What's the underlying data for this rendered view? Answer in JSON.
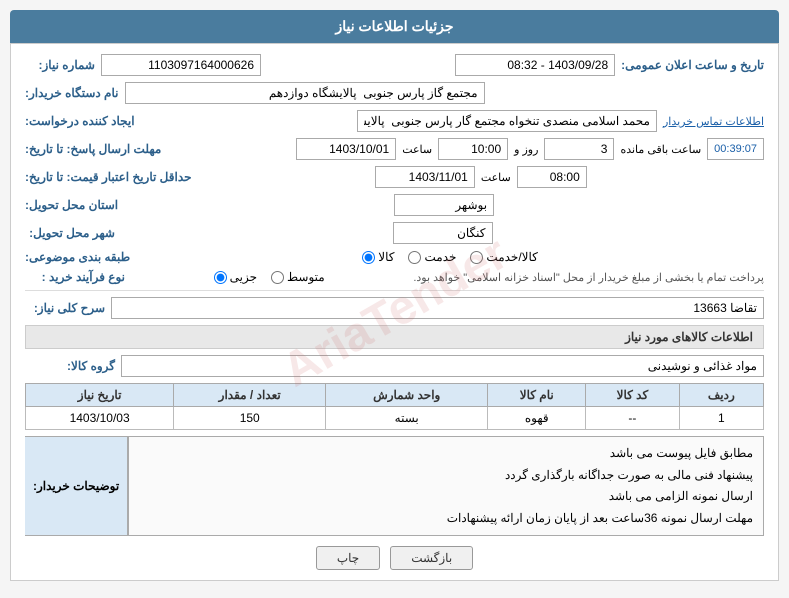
{
  "header": {
    "title": "جزئیات اطلاعات نیاز"
  },
  "fields": {
    "shomara_niaz_label": "شماره نیاز:",
    "shomara_niaz_value": "1103097164000626",
    "tarikh_label": "تاریخ و ساعت اعلان عمومی:",
    "tarikh_value": "1403/09/28 - 08:32",
    "nam_dastgah_label": "نام دستگاه خریدار:",
    "nam_dastgah_value": "مجتمع گاز پارس جنوبی  پالایشگاه دوازدهم",
    "ijad_konande_label": "ایجاد کننده درخواست:",
    "ijad_konande_value": "محمد اسلامی منصدی تنخواه مجتمع گار پارس جنوبی  پالایشگاه دوازدهم",
    "ettelaat_tamas_label": "اطلاعات تماس خریدار",
    "mohlat_ersal_label": "مهلت ارسال پاسخ: تا تاریخ:",
    "mohlat_ersal_date": "1403/10/01",
    "mohlat_ersal_saat": "10:00",
    "mohlat_ersal_saat_label": "ساعت",
    "rooz_label": "روز و",
    "rooz_value": "3",
    "baqi_saat_label": "ساعت باقی مانده",
    "baqi_value": "00:39:07",
    "hadaghal_label": "حداقل تاریخ اعتبار قیمت: تا تاریخ:",
    "hadaghal_date": "1403/11/01",
    "hadaghal_saat": "08:00",
    "hadaghal_saat_label": "ساعت",
    "ostan_label": "استان محل تحویل:",
    "ostan_value": "بوشهر",
    "shahr_label": "شهر محل تحویل:",
    "shahr_value": "کنگان",
    "tabagheh_label": "طبقه بندی موضوعی:",
    "tabagheh_kala": "کالا",
    "tabagheh_khadamat": "خدمت",
    "tabagheh_kala_khadamat": "کالا/خدمت",
    "noe_farayand_label": "نوع فرآیند خرید :",
    "noe_jozii": "جزیی",
    "noe_motavasset": "متوسط",
    "noe_description": "پرداخت تمام یا بخشی از مبلغ خریدار از محل \"اسناد خزانه اسلامی\" خواهد بود.",
    "sarh_koli_label": "سرح کلی نیاز:",
    "sarh_koli_value": "تقاضا 13663",
    "ettelaat_header": "اطلاعات کالاهای مورد نیاز",
    "gorohe_kala_label": "گروه کالا:",
    "gorohe_kala_value": "مواد غذائی و نوشیدنی",
    "table": {
      "headers": [
        "ردیف",
        "کد کالا",
        "نام کالا",
        "واحد شمارش",
        "تعداد / مقدار",
        "تاریخ نیاز"
      ],
      "rows": [
        [
          "1",
          "--",
          "قهوه",
          "بسته",
          "150",
          "1403/10/03"
        ]
      ]
    },
    "notes_label": "توضیحات خریدار:",
    "notes_lines": [
      "مطابق فایل پیوست می باشد",
      "پیشنهاد فنی مالی به صورت جداگانه بارگذاری گردد",
      "ارسال نمونه الزامی می باشد",
      "مهلت ارسال نمونه 36ساعت بعد از پایان زمان ارائه پیشنهادات"
    ],
    "btn_print": "چاپ",
    "btn_back": "بازگشت"
  }
}
